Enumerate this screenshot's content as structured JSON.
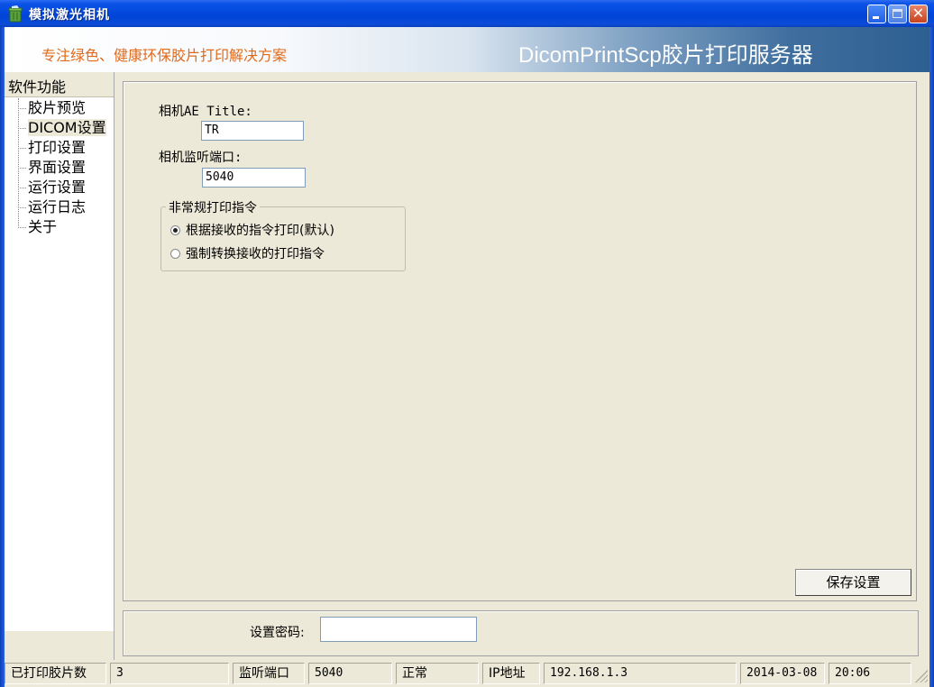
{
  "window": {
    "title": "模拟激光相机",
    "icon": "trash-bin-icon",
    "controls": {
      "minimize": "minimize-icon",
      "maximize": "maximize-icon",
      "close": "close-icon"
    }
  },
  "banner": {
    "slogan": "专注绿色、健康环保胶片打印解决方案",
    "product_name": "DicomPrintScp胶片打印服务器"
  },
  "nav": {
    "header": "软件功能",
    "items": [
      {
        "label": "胶片预览",
        "selected": false
      },
      {
        "label": "DICOM设置",
        "selected": true
      },
      {
        "label": "打印设置",
        "selected": false
      },
      {
        "label": "界面设置",
        "selected": false
      },
      {
        "label": "运行设置",
        "selected": false
      },
      {
        "label": "运行日志",
        "selected": false
      },
      {
        "label": "关于",
        "selected": false
      }
    ]
  },
  "dicom": {
    "ae_title_label": "相机AE Title:",
    "ae_title_value": "TR",
    "port_label": "相机监听端口:",
    "port_value": "5040",
    "print_group": {
      "title": "非常规打印指令",
      "options": [
        {
          "label": "根据接收的指令打印(默认)",
          "checked": true
        },
        {
          "label": "强制转换接收的打印指令",
          "checked": false
        }
      ]
    },
    "save_button": "保存设置"
  },
  "password": {
    "label": "设置密码:",
    "value": ""
  },
  "status_bar": {
    "printed_label": "已打印胶片数",
    "printed_value": "3",
    "port_label": "监听端口",
    "port_value": "5040",
    "state": "正常",
    "ip_label": "IP地址",
    "ip_value": "192.168.1.3",
    "date": "2014-03-08",
    "time": "20:06"
  },
  "colors": {
    "titlebar": "#0045d8",
    "slogan": "#e06a1c",
    "banner_dark": "#2e5f92",
    "window_bg": "#ECE9D8"
  }
}
